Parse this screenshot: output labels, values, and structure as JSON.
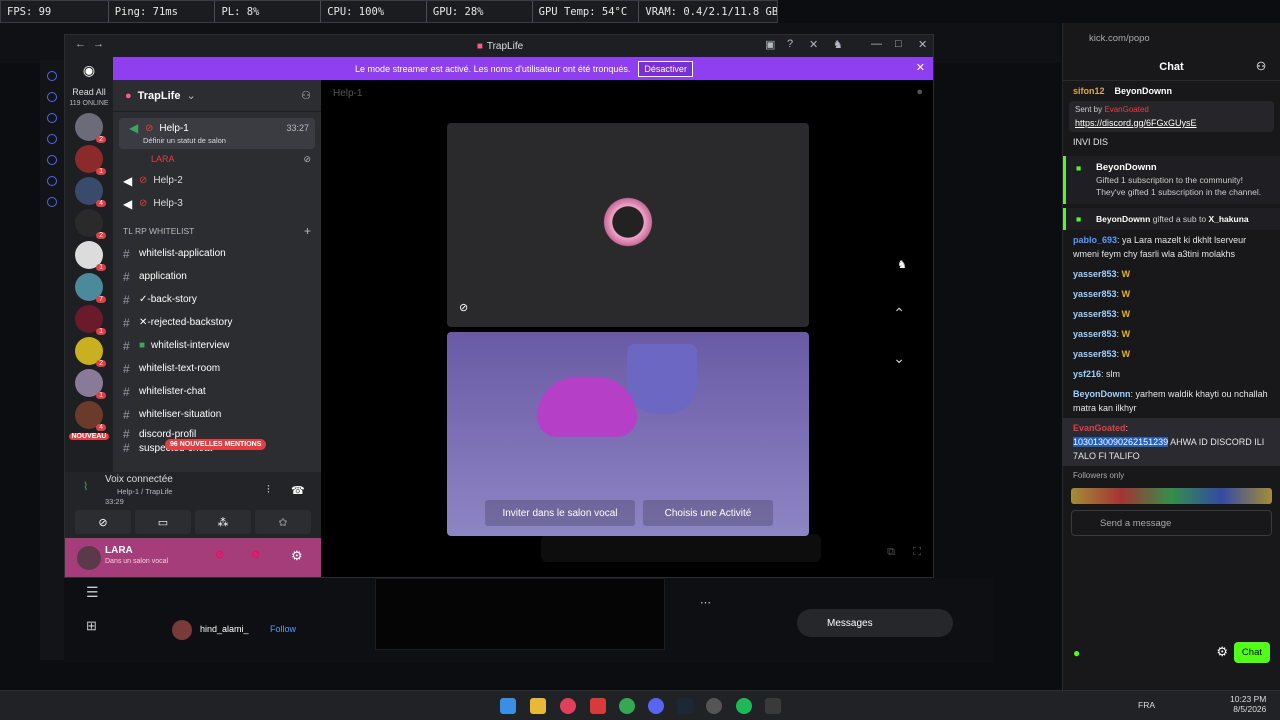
{
  "overlay": {
    "fps": "FPS: 99",
    "ping": "Ping: 71ms",
    "pl": "PL: 8%",
    "cpu": "CPU: 100%",
    "gpu": "GPU: 28%",
    "gpu_temp": "GPU Temp: 54°C",
    "vram": "VRAM: 0.4/2.1/11.8 GB"
  },
  "discord": {
    "window_title": "TrapLife",
    "banner_text": "Le mode streamer est activé. Les noms d'utilisateur ont été tronqués.",
    "banner_button": "Désactiver",
    "read_all": "Read All",
    "online_count": "119 ONLINE",
    "server_name": "TrapLife",
    "stage_header": "Help-1",
    "channels": [
      {
        "name": "Help-1",
        "time": "33:27",
        "sub": "Définir un statut de salon"
      },
      {
        "name": "LARA"
      },
      {
        "name": "Help-2"
      },
      {
        "name": "Help-3"
      },
      {
        "name": "TL RP WHITELIST"
      },
      {
        "name": "whitelist-application"
      },
      {
        "name": "application"
      },
      {
        "name": "✓-back-story"
      },
      {
        "name": "✕-rejected-backstory"
      },
      {
        "name": "whitelist-interview"
      },
      {
        "name": "whitelist-text-room"
      },
      {
        "name": "whitelister-chat"
      },
      {
        "name": "whiteliser-situation"
      },
      {
        "name": "discord-profil"
      },
      {
        "name": "suspected-cheat"
      }
    ],
    "nouveau_badge": "NOUVEAU",
    "mentions_badge": "96 NOUVELLES MENTIONS",
    "voice_status": "Voix connectée",
    "voice_channel": "Help-1 / TrapLife",
    "voice_time": "33:29",
    "user_name": "LARA",
    "user_status": "Dans un salon vocal",
    "invite_btn": "Inviter dans le salon vocal",
    "activity_btn": "Choisis une Activité"
  },
  "stream_overlay": {
    "streamer": "hind_alami_",
    "follow": "Follow",
    "messages": "Messages"
  },
  "chat": {
    "title": "Chat",
    "url_bar": "kick.com/popo",
    "pinned_top": "sifon12",
    "pinned_top2": "BeyonDownn",
    "pinned_sent_by": "Sent by",
    "pinned_user": "EvanGoated",
    "pinned_link": "https://discord.gg/6FGxGUysE",
    "partial_line": "INVI DIS",
    "gift_title": "BeyonDownn",
    "gift_text": "Gifted 1 subscription to the community! They've gifted 1 subscription in the channel.",
    "gift_sub_user": "BeyonDownn",
    "gift_sub_text": "gifted a sub to",
    "gift_sub_target": "X_hakuna",
    "messages": [
      {
        "user": "pablo_693",
        "text": "ya Lara mazelt ki dkhlt lserveur wmeni feym chy fasrli wla a3tini molakhs",
        "color": "#5b9bff"
      },
      {
        "user": "yasser853",
        "text": "W",
        "color": "#9ed0ff"
      },
      {
        "user": "yasser853",
        "text": "W",
        "color": "#9ed0ff"
      },
      {
        "user": "yasser853",
        "text": "W",
        "color": "#9ed0ff"
      },
      {
        "user": "yasser853",
        "text": "W",
        "color": "#9ed0ff"
      },
      {
        "user": "yasser853",
        "text": "W",
        "color": "#9ed0ff"
      },
      {
        "user": "ysf216",
        "text": "slm",
        "color": "#9ed0ff"
      },
      {
        "user": "BeyonDownn",
        "text": "yarhem waldik khayti ou nchallah matra kan ilkhyr",
        "color": "#9ed0ff"
      }
    ],
    "last_user": "EvanGoated",
    "last_text1": "1030130090262151239",
    "last_text2": " AHWA ID DISCORD ILI 7ALO FI TALIFO",
    "followers_only": "Followers only",
    "send_placeholder": "Send a message",
    "send_btn": "Chat"
  },
  "taskbar": {
    "lang": "FRA",
    "time": "10:23 PM",
    "date": "8/5/2026"
  }
}
